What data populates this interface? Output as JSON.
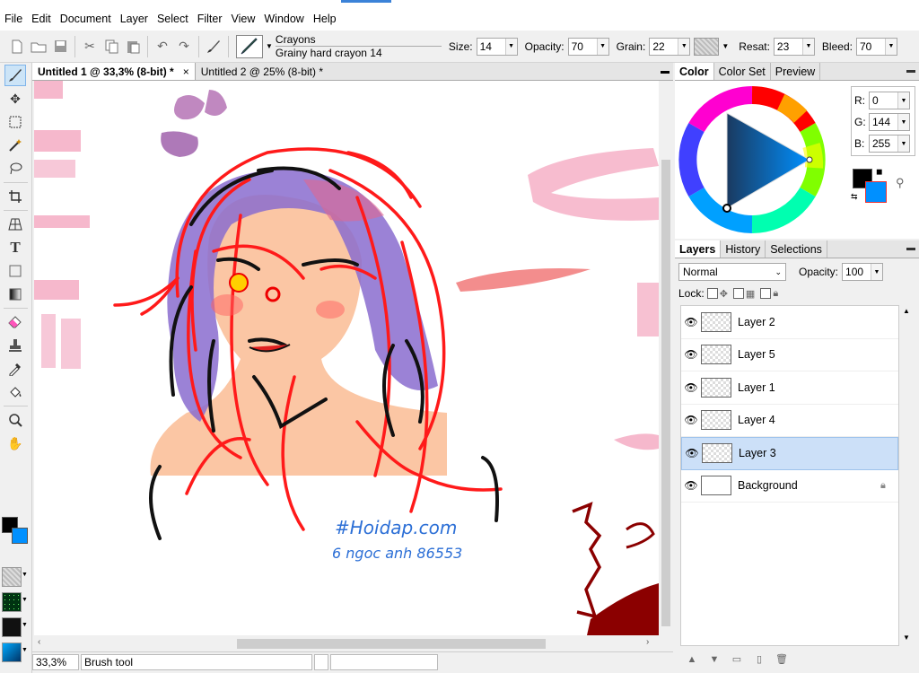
{
  "menu": [
    "File",
    "Edit",
    "Document",
    "Layer",
    "Select",
    "Filter",
    "View",
    "Window",
    "Help"
  ],
  "toolbar": {
    "preset_name": "Crayons",
    "preset_brush": "Grainy hard crayon 14",
    "size_label": "Size:",
    "size_value": "14",
    "opacity_label": "Opacity:",
    "opacity_value": "70",
    "grain_label": "Grain:",
    "grain_value": "22",
    "resat_label": "Resat:",
    "resat_value": "23",
    "bleed_label": "Bleed:",
    "bleed_value": "70"
  },
  "documents": [
    {
      "title": "Untitled 1 @ 33,3% (8-bit) *",
      "close": "×"
    },
    {
      "title": "Untitled 2 @ 25% (8-bit) *"
    }
  ],
  "canvas_text": {
    "line1": "#Hoidap.com",
    "line2": "6 ngoc anh 86553"
  },
  "status": {
    "zoom": "33,3%",
    "tool": "Brush tool"
  },
  "color_panel": {
    "tabs": [
      "Color",
      "Color Set",
      "Preview"
    ],
    "r_label": "R:",
    "r_value": "0",
    "g_label": "G:",
    "g_value": "144",
    "b_label": "B:",
    "b_value": "255",
    "primary_color": "#000000",
    "secondary_color": "#0090ff"
  },
  "layers_panel": {
    "tabs": [
      "Layers",
      "History",
      "Selections"
    ],
    "blend_mode": "Normal",
    "opacity_label": "Opacity:",
    "opacity_value": "100",
    "lock_label": "Lock:",
    "layers": [
      {
        "name": "Layer 2",
        "selected": false
      },
      {
        "name": "Layer 5",
        "selected": false
      },
      {
        "name": "Layer 1",
        "selected": false
      },
      {
        "name": "Layer 4",
        "selected": false
      },
      {
        "name": "Layer 3",
        "selected": true
      },
      {
        "name": "Background",
        "selected": false,
        "locked": true
      }
    ]
  },
  "colors": {
    "accent": "#3b82d8",
    "selection": "#cce0f8"
  }
}
